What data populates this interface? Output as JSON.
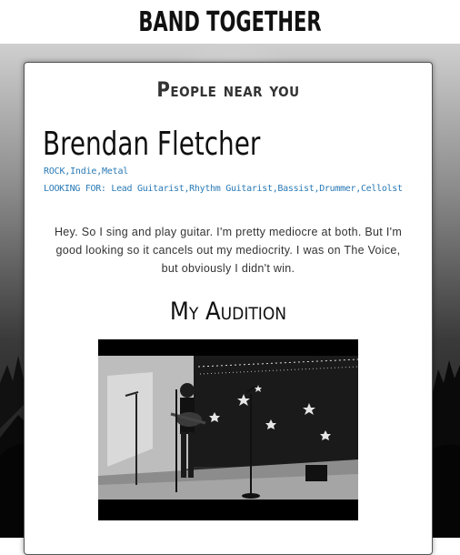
{
  "app": {
    "title": "BAND TOGETHER"
  },
  "page": {
    "section_title": "People near you"
  },
  "profile": {
    "name": "Brendan Fletcher",
    "genres": "ROCK,Indie,Metal",
    "looking_for": "LOOKING FOR: Lead Guitarist,Rhythm Guitarist,Bassist,Drummer,Cellolst",
    "bio": "Hey. So I sing and play guitar. I'm pretty mediocre at both. But I'm good looking so it cancels out my mediocrity. I was on The Voice, but obviously I didn't win."
  },
  "audition": {
    "title": "My Audition"
  },
  "colors": {
    "accent": "#2a7ab6",
    "card_bg": "#ffffff",
    "page_bg": "#0b0b0b"
  }
}
